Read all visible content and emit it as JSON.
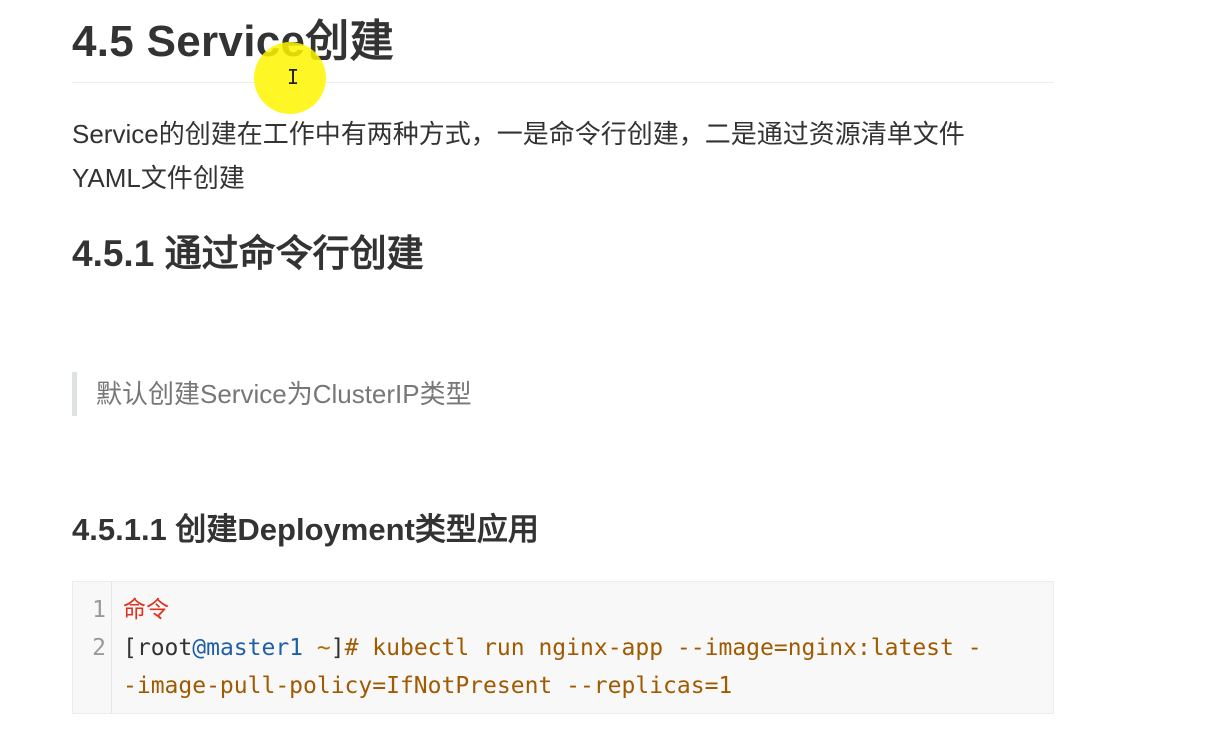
{
  "headings": {
    "h2": "4.5 Service创建",
    "h3": "4.5.1 通过命令行创建",
    "h4": "4.5.1.1 创建Deployment类型应用"
  },
  "paragraph": {
    "line1": "Service的创建在工作中有两种方式，一是命令行创建，二是通过资源清单文件",
    "line2": "YAML文件创建"
  },
  "blockquote": "默认创建Service为ClusterIP类型",
  "code_block": {
    "line_numbers": [
      "1",
      "2"
    ],
    "line1_comment": "命令",
    "line2_prompt_open": "[root",
    "line2_host": "@master1",
    "line2_tilde": " ~",
    "line2_prompt_close": "]",
    "line2_command_part1": "# kubectl run nginx-app --image=nginx:latest -",
    "line2_command_part2": "-image-pull-policy=IfNotPresent --replicas=1"
  },
  "cursor": {
    "icon": "text-cursor-icon",
    "glyph": "I",
    "highlight_color": "#fff400"
  }
}
